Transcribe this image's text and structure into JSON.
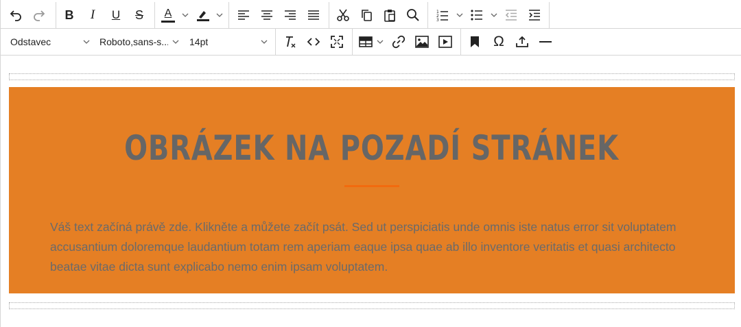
{
  "toolbar1": {
    "undo": "undo-icon",
    "redo": "redo-icon",
    "bold": "B",
    "italic": "I",
    "underline": "U",
    "strikethrough": "S",
    "text_color": "A",
    "text_color_value": "#222222",
    "highlight_color_value": "#222222"
  },
  "toolbar2": {
    "block_format": "Odstavec",
    "font_family": "Roboto,sans-s...",
    "font_size": "14pt",
    "symbol": "Ω"
  },
  "hero": {
    "title": "OBRÁZEK NA POZADÍ STRÁNEK",
    "text": "Váš text začíná právě zde. Klikněte a můžete začít psát. Sed ut perspiciatis unde omnis iste natus error sit voluptatem accusantium doloremque laudantium totam rem aperiam eaque ipsa quae ab illo inventore veritatis et quasi architecto beatae vitae dicta sunt explicabo nemo enim ipsam voluptatem.",
    "background_color": "#e57f24",
    "accent_color": "#f26b0f"
  }
}
